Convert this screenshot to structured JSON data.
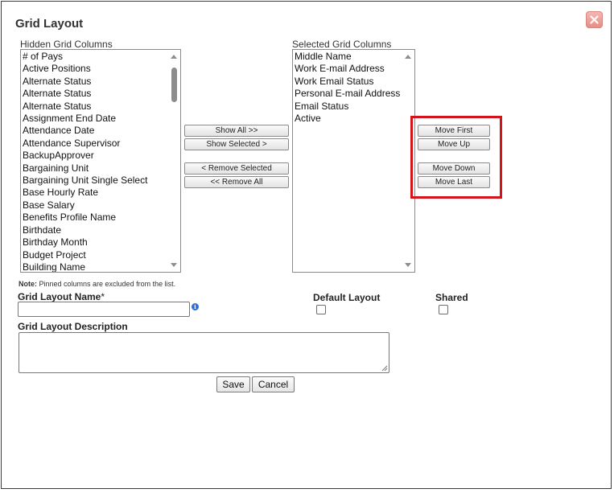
{
  "dialog": {
    "title": "Grid Layout",
    "close_icon": "close-x-icon"
  },
  "hidden_columns": {
    "label": "Hidden Grid Columns",
    "items": [
      "# of Pays",
      "Active Positions",
      "Alternate Status",
      "Alternate Status",
      "Alternate Status",
      "Assignment End Date",
      "Attendance Date",
      "Attendance Supervisor",
      "BackupApprover",
      "Bargaining Unit",
      "Bargaining Unit Single Select",
      "Base Hourly Rate",
      "Base Salary",
      "Benefits Profile Name",
      "Birthdate",
      "Birthday Month",
      "Budget Project",
      "Building Name"
    ]
  },
  "transfer_buttons": {
    "show_all": "Show All >>",
    "show_selected": "Show Selected >",
    "remove_selected": "< Remove Selected",
    "remove_all": "<< Remove All"
  },
  "selected_columns": {
    "label": "Selected Grid Columns",
    "items": [
      "Middle Name",
      "Work E-mail Address",
      "Work Email Status",
      "Personal E-mail Address",
      "Email Status",
      "Active"
    ]
  },
  "order_buttons": {
    "move_first": "Move First",
    "move_up": "Move Up",
    "move_down": "Move Down",
    "move_last": "Move Last"
  },
  "note": {
    "prefix": "Note:",
    "text": " Pinned columns are excluded from the list."
  },
  "form": {
    "name_label": "Grid Layout Name",
    "required_marker": "*",
    "name_value": "",
    "default_layout_label": "Default Layout",
    "default_layout_checked": false,
    "shared_label": "Shared",
    "shared_checked": false,
    "description_label": "Grid Layout Description",
    "description_value": ""
  },
  "actions": {
    "save": "Save",
    "cancel": "Cancel"
  },
  "colors": {
    "highlight": "#d4141b",
    "close_button": "#e78d86"
  }
}
